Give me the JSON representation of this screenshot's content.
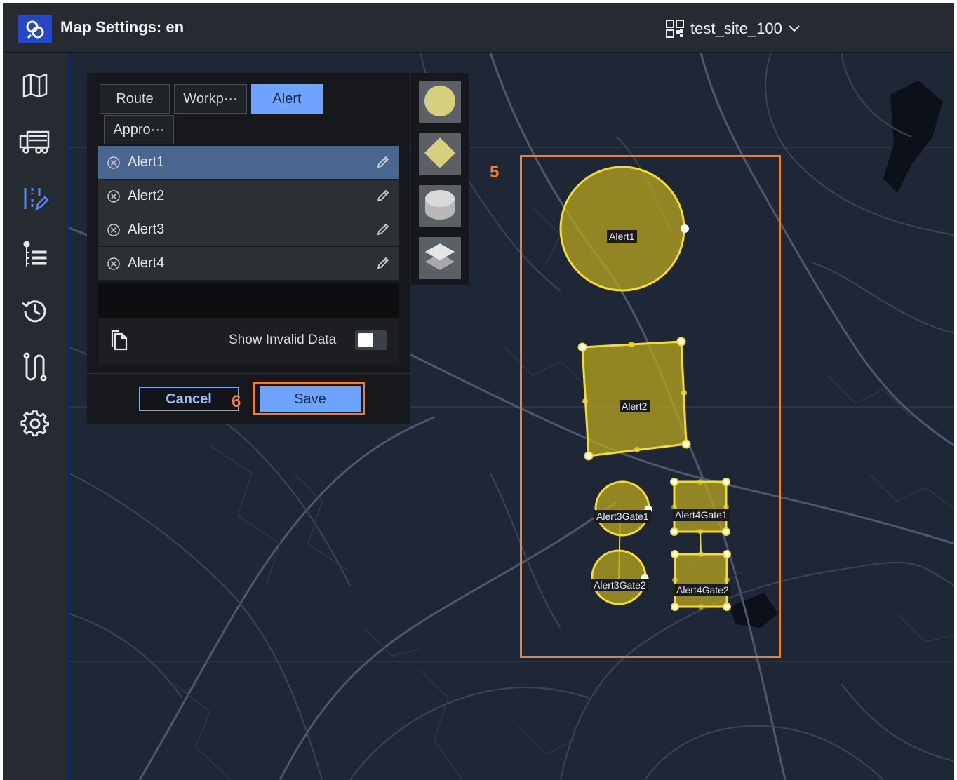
{
  "header": {
    "title": "Map Settings: en",
    "site": "test_site_100",
    "logo_icon": "link-logo-icon",
    "site_icon": "qr-code-icon",
    "chevron_icon": "chevron-down-icon"
  },
  "sidenav": {
    "items": [
      {
        "name": "map",
        "icon": "map-icon"
      },
      {
        "name": "vehicle",
        "icon": "truck-icon"
      },
      {
        "name": "map-settings",
        "icon": "edit-layout-icon",
        "active": true
      },
      {
        "name": "list",
        "icon": "list-icon"
      },
      {
        "name": "history",
        "icon": "history-icon"
      },
      {
        "name": "route",
        "icon": "route-icon"
      },
      {
        "name": "settings",
        "icon": "gear-icon"
      }
    ]
  },
  "panel": {
    "tabs": [
      {
        "label": "Route"
      },
      {
        "label": "Workp···"
      },
      {
        "label": "Alert",
        "active": true
      },
      {
        "label": "Appro···"
      }
    ],
    "alerts": [
      {
        "name": "Alert1",
        "selected": true
      },
      {
        "name": "Alert2"
      },
      {
        "name": "Alert3"
      },
      {
        "name": "Alert4"
      }
    ],
    "show_invalid_label": "Show Invalid Data",
    "show_invalid_on": false,
    "cancel_label": "Cancel",
    "save_label": "Save"
  },
  "shape_tools": [
    {
      "name": "circle",
      "icon": "circle-shape-icon"
    },
    {
      "name": "polygon",
      "icon": "diamond-shape-icon"
    },
    {
      "name": "cylinder",
      "icon": "cylinder-shape-icon"
    },
    {
      "name": "layers",
      "icon": "layers-icon"
    }
  ],
  "annotations": {
    "step5": "5",
    "step6": "6",
    "color": "#f07f2c"
  },
  "zones": [
    {
      "label": "Alert1"
    },
    {
      "label": "Alert2"
    },
    {
      "label": "Alert3Gate1"
    },
    {
      "label": "Alert3Gate2"
    },
    {
      "label": "Alert4Gate1"
    },
    {
      "label": "Alert4Gate2"
    }
  ],
  "colors": {
    "accent": "#6ea3ff",
    "zone_fill": "#b9a51f",
    "zone_stroke": "#f2de2c",
    "map_bg": "#1f2636"
  }
}
